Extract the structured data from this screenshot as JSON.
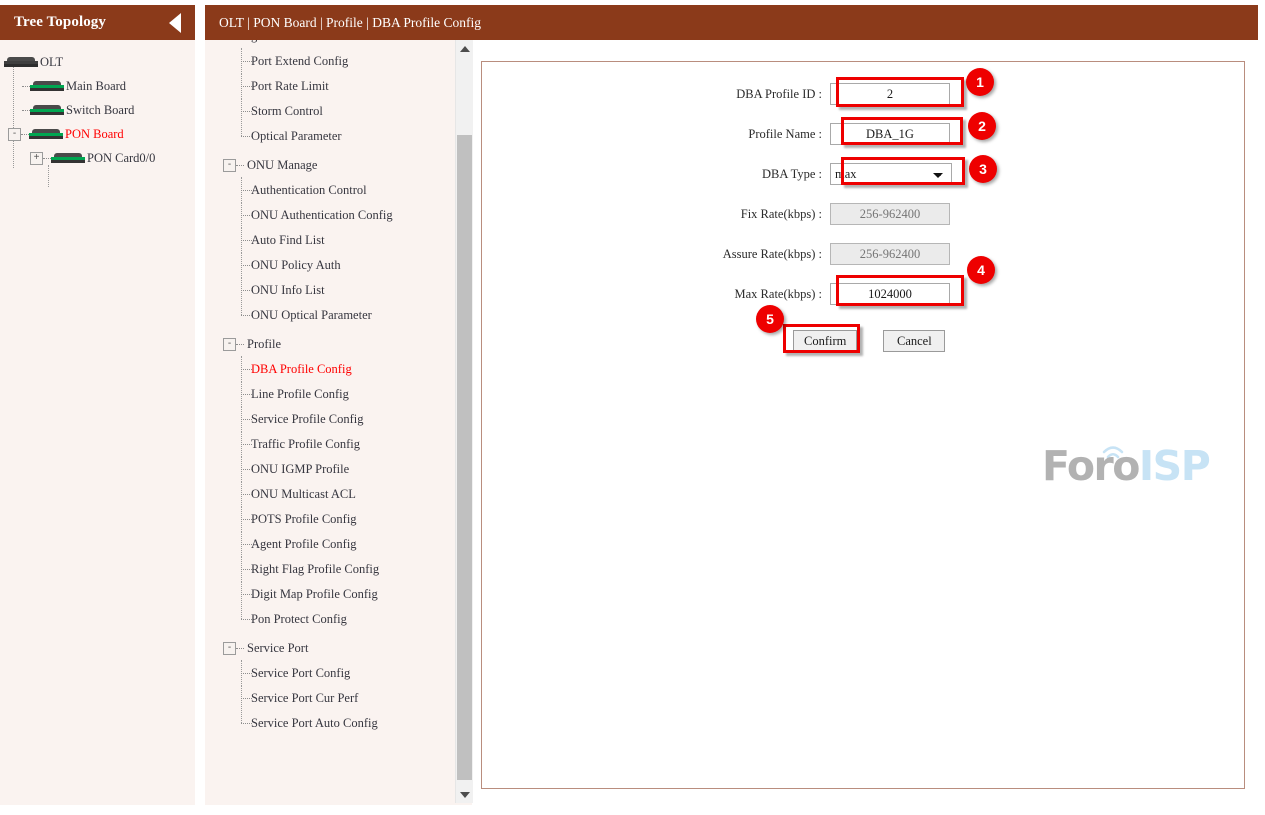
{
  "tree_panel": {
    "header_title": "Tree Topology",
    "collapse_icon": "left-triangle-icon",
    "nodes": [
      {
        "label": "OLT",
        "icon": "device-icon",
        "expander": "",
        "level": 0,
        "active": false
      },
      {
        "label": "Main Board",
        "icon": "device-icon",
        "expander": "",
        "level": 1,
        "active": false
      },
      {
        "label": "Switch Board",
        "icon": "device-icon",
        "expander": "",
        "level": 1,
        "active": false
      },
      {
        "label": "PON Board",
        "icon": "device-green-icon",
        "expander": "-",
        "level": 1,
        "active": true
      },
      {
        "label": "PON Card0/0",
        "icon": "device-green-icon",
        "expander": "+",
        "level": 2,
        "active": false
      }
    ]
  },
  "breadcrumb": {
    "text": "OLT | PON Board | Profile | DBA Profile Config"
  },
  "menu": {
    "partial_top_item": "g",
    "groups": [
      {
        "name": "",
        "expander": "",
        "items": [
          {
            "label": "Port Extend Config",
            "selected": false,
            "last": false
          },
          {
            "label": "Port Rate Limit",
            "selected": false,
            "last": false
          },
          {
            "label": "Storm Control",
            "selected": false,
            "last": false
          },
          {
            "label": "Optical Parameter",
            "selected": false,
            "last": true
          }
        ]
      },
      {
        "name": "ONU Manage",
        "expander": "-",
        "items": [
          {
            "label": "Authentication Control",
            "selected": false,
            "last": false
          },
          {
            "label": "ONU Authentication Config",
            "selected": false,
            "last": false
          },
          {
            "label": "Auto Find List",
            "selected": false,
            "last": false
          },
          {
            "label": "ONU Policy Auth",
            "selected": false,
            "last": false
          },
          {
            "label": "ONU Info List",
            "selected": false,
            "last": false
          },
          {
            "label": "ONU Optical Parameter",
            "selected": false,
            "last": true
          }
        ]
      },
      {
        "name": "Profile",
        "expander": "-",
        "items": [
          {
            "label": "DBA Profile Config",
            "selected": true,
            "last": false
          },
          {
            "label": "Line Profile Config",
            "selected": false,
            "last": false
          },
          {
            "label": "Service Profile Config",
            "selected": false,
            "last": false
          },
          {
            "label": "Traffic Profile Config",
            "selected": false,
            "last": false
          },
          {
            "label": "ONU IGMP Profile",
            "selected": false,
            "last": false
          },
          {
            "label": "ONU Multicast ACL",
            "selected": false,
            "last": false
          },
          {
            "label": "POTS Profile Config",
            "selected": false,
            "last": false
          },
          {
            "label": "Agent Profile Config",
            "selected": false,
            "last": false
          },
          {
            "label": "Right Flag Profile Config",
            "selected": false,
            "last": false
          },
          {
            "label": "Digit Map Profile Config",
            "selected": false,
            "last": false
          },
          {
            "label": "Pon Protect Config",
            "selected": false,
            "last": true
          }
        ]
      },
      {
        "name": "Service Port",
        "expander": "-",
        "items": [
          {
            "label": "Service Port Config",
            "selected": false,
            "last": false
          },
          {
            "label": "Service Port Cur Perf",
            "selected": false,
            "last": false
          },
          {
            "label": "Service Port Auto Config",
            "selected": false,
            "last": true
          }
        ]
      }
    ],
    "scrollbar": {
      "up_icon": "scroll-up-arrow-icon",
      "down_icon": "scroll-down-arrow-icon"
    }
  },
  "form": {
    "fields": [
      {
        "label": "DBA Profile ID :",
        "value": "2",
        "placeholder": "",
        "type": "text",
        "disabled": false
      },
      {
        "label": "Profile Name :",
        "value": "DBA_1G",
        "placeholder": "",
        "type": "text",
        "disabled": false
      },
      {
        "label": "DBA Type :",
        "value": "max",
        "placeholder": "",
        "type": "select",
        "disabled": false,
        "options": [
          "max"
        ]
      },
      {
        "label": "Fix Rate(kbps) :",
        "value": "",
        "placeholder": "256-962400",
        "type": "text",
        "disabled": true
      },
      {
        "label": "Assure Rate(kbps) :",
        "value": "",
        "placeholder": "256-962400",
        "type": "text",
        "disabled": true
      },
      {
        "label": "Max Rate(kbps) :",
        "value": "1024000",
        "placeholder": "",
        "type": "text",
        "disabled": false
      }
    ],
    "confirm_label": "Confirm",
    "cancel_label": "Cancel"
  },
  "annotations": {
    "accent_color": "#ee0000",
    "badges": [
      {
        "number": "1"
      },
      {
        "number": "2"
      },
      {
        "number": "3"
      },
      {
        "number": "4"
      },
      {
        "number": "5"
      }
    ]
  },
  "watermark": {
    "part1": "Foro",
    "part2": "ISP",
    "color1": "#b2b2b2",
    "color2": "#c7e3f5"
  },
  "theme": {
    "header_bg": "#8b3a1a",
    "panel_bg": "#faf3f0",
    "content_border": "#b98d7e"
  }
}
